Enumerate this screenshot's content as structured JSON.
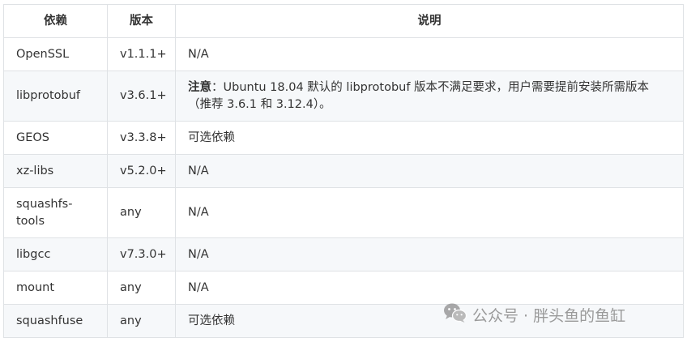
{
  "table": {
    "headers": [
      "依赖",
      "版本",
      "说明"
    ],
    "rows": [
      {
        "dep": "OpenSSL",
        "version": "v1.1.1+",
        "note": "N/A"
      },
      {
        "dep": "libprotobuf",
        "version": "v3.6.1+",
        "note_strong": "注意",
        "note": "：Ubuntu 18.04 默认的 libprotobuf 版本不满足要求，用户需要提前安装所需版本（推荐 3.6.1 和 3.12.4）。"
      },
      {
        "dep": "GEOS",
        "version": "v3.3.8+",
        "note": "可选依赖"
      },
      {
        "dep": "xz-libs",
        "version": "v5.2.0+",
        "note": "N/A"
      },
      {
        "dep": "squashfs-tools",
        "version": "any",
        "note": "N/A"
      },
      {
        "dep": "libgcc",
        "version": "v7.3.0+",
        "note": "N/A"
      },
      {
        "dep": "mount",
        "version": "any",
        "note": "N/A"
      },
      {
        "dep": "squashfuse",
        "version": "any",
        "note": "可选依赖"
      }
    ]
  },
  "watermark": {
    "text": "公众号 · 胖头鱼的鱼缸",
    "icon": "wechat-icon"
  }
}
